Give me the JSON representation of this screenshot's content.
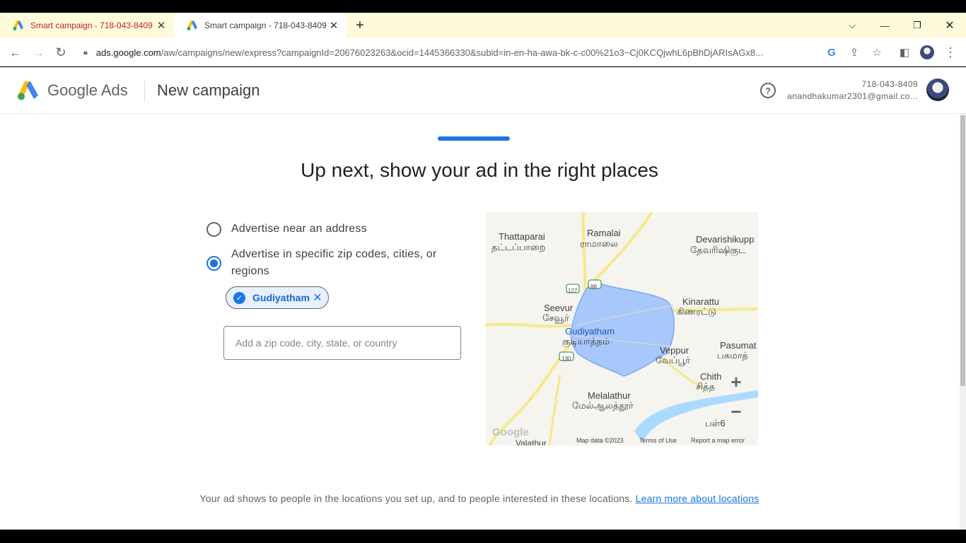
{
  "browser": {
    "tabs": [
      {
        "title": "Smart campaign - 718-043-8409"
      },
      {
        "title": "Smart campaign - 718-043-8409"
      }
    ],
    "new_tab_symbol": "+",
    "url_host": "ads.google.com",
    "url_rest": "/aw/campaigns/new/express?campaignId=20676023263&ocid=1445366330&subid=in-en-ha-awa-bk-c-c00%21o3~Cj0KCQjwhL6pBhDjARIsAGx8..."
  },
  "header": {
    "brand": "Google Ads",
    "page_title": "New campaign",
    "help_symbol": "?",
    "account_id": "718-043-8409",
    "account_email": "anandhakumar2301@gmail.co..."
  },
  "main": {
    "heading": "Up next, show your ad in the right places",
    "options": [
      {
        "label": "Advertise near an address",
        "selected": false
      },
      {
        "label": "Advertise in specific zip codes, cities, or regions",
        "selected": true
      }
    ],
    "chip": {
      "label": "Gudiyatham",
      "remove_symbol": "✕",
      "check_symbol": "✓"
    },
    "location_input": {
      "value": "",
      "placeholder": "Add a zip code, city, state, or country"
    },
    "disclaimer_text": "Your ad shows to people in the locations you set up, and to people interested in these locations.",
    "disclaimer_link": "Learn more about locations"
  },
  "map": {
    "labels": {
      "thattaparai": "Thattaparai",
      "thattaparai_ta": "தட்டப்பாறை",
      "ramalai": "Ramalai",
      "ramalai_ta": "ராமாலை",
      "devarishikupp": "Devarishikupp",
      "devarishikupp_ta": "தேவரிஷிகுட",
      "seevur": "Seevur",
      "seevur_ta": "சேவூர்",
      "gudiyatham": "Gudiyatham",
      "gudiyatham_ta": "குடியாத்தம்",
      "kinarattu": "Kinarattu",
      "kinarattu_ta": "கிணரட்டு",
      "pasumat": "Pasumat",
      "pasumat_ta": "பசுமாத்",
      "veppur": "Veppur",
      "veppur_ta": "வேப்பூர்",
      "chith": "Chith",
      "chith_ta": "சித்த",
      "melalathur": "Melalathur",
      "melalathur_ta": "மேல்ஆலத்தூர்",
      "valathur": "Valathur",
      "pal_ta": "பள்6"
    },
    "route_shields": [
      "127",
      "88",
      "130"
    ],
    "zoom_in": "+",
    "zoom_out": "−",
    "google_logo": "Google",
    "map_data": "Map data ©2023",
    "terms": "Terms of Use",
    "report": "Report a map error"
  },
  "colors": {
    "accent": "#1a73e8",
    "region_fill": "#a8c7fa",
    "road": "#f7e88a"
  }
}
